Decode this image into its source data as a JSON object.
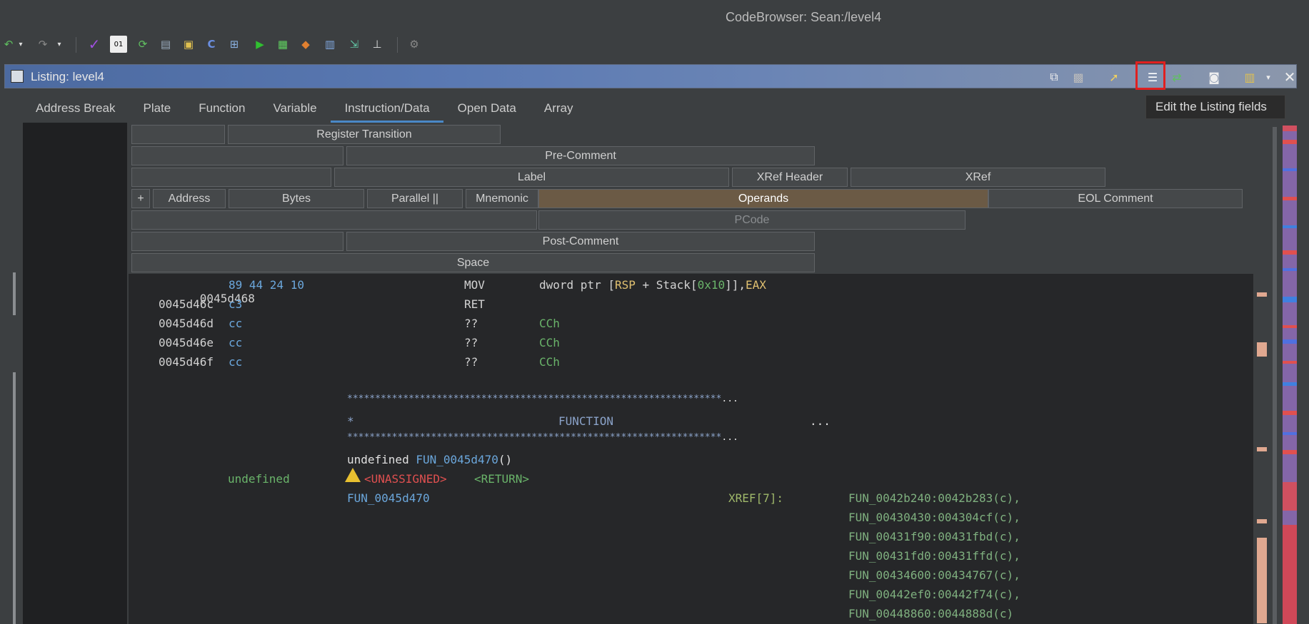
{
  "window": {
    "title": "CodeBrowser: Sean:/level4"
  },
  "toolbar": {
    "icons": [
      "undo-icon",
      "redo-icon",
      "checkmark-icon",
      "binary-icon",
      "refresh-icon",
      "memory-map-icon",
      "folder-icon",
      "color-icon",
      "tree-icon",
      "run-icon",
      "chip-icon",
      "diamond-icon",
      "table-icon",
      "export-icon",
      "hierarchy-icon",
      "gear-icon"
    ]
  },
  "listing_panel": {
    "title": "Listing:  level4",
    "tools": [
      "copy-icon",
      "paste-icon",
      "cursor-highlight-icon",
      "edit-fields-icon",
      "diff-icon",
      "snapshot-icon",
      "layout-icon",
      "close-icon"
    ],
    "tooltip": "Edit the Listing fields"
  },
  "tabs": [
    "Address Break",
    "Plate",
    "Function",
    "Variable",
    "Instruction/Data",
    "Open Data",
    "Array"
  ],
  "active_tab": "Instruction/Data",
  "fields": {
    "register_transition": "Register Transition",
    "pre_comment": "Pre-Comment",
    "label": "Label",
    "xref_header": "XRef Header",
    "xref": "XRef",
    "plus": "+",
    "address": "Address",
    "bytes": "Bytes",
    "parallel": "Parallel ||",
    "mnemonic": "Mnemonic",
    "operands": "Operands",
    "eol_comment": "EOL Comment",
    "pcode": "PCode",
    "post_comment": "Post-Comment",
    "space": "Space"
  },
  "instructions": [
    {
      "addr": "0045d468",
      "bytes": "89 44 24 10",
      "mnemonic": "MOV",
      "op1": "dword ptr [",
      "op_reg1": "RSP",
      "op2": " + Stack[",
      "op_num": "0x10",
      "op3": "]],",
      "op_reg2": "EAX"
    },
    {
      "addr": "0045d46c",
      "bytes": "c3",
      "mnemonic": "RET"
    },
    {
      "addr": "0045d46d",
      "bytes": "cc",
      "mnemonic": "??",
      "operand": "CCh"
    },
    {
      "addr": "0045d46e",
      "bytes": "cc",
      "mnemonic": "??",
      "operand": "CCh"
    },
    {
      "addr": "0045d46f",
      "bytes": "cc",
      "mnemonic": "??",
      "operand": "CCh"
    }
  ],
  "plate": {
    "stars": "*******************************************************************",
    "ellipsis": "...",
    "star": "*",
    "function_label": "FUNCTION"
  },
  "function": {
    "signature_type": "undefined ",
    "signature_name": "FUN_0045d470",
    "signature_args": "()",
    "return_type": "undefined",
    "unassigned": "<UNASSIGNED>",
    "return": "<RETURN>",
    "label": "FUN_0045d470",
    "xref_header": "XREF[7]:",
    "xrefs": [
      "FUN_0042b240:0042b283(c),",
      "FUN_00430430:004304cf(c),",
      "FUN_00431f90:00431fbd(c),",
      "FUN_00431fd0:00431ffd(c),",
      "FUN_00434600:00434767(c),",
      "FUN_00442ef0:00442f74(c),",
      "FUN_00448860:0044888d(c)"
    ]
  }
}
